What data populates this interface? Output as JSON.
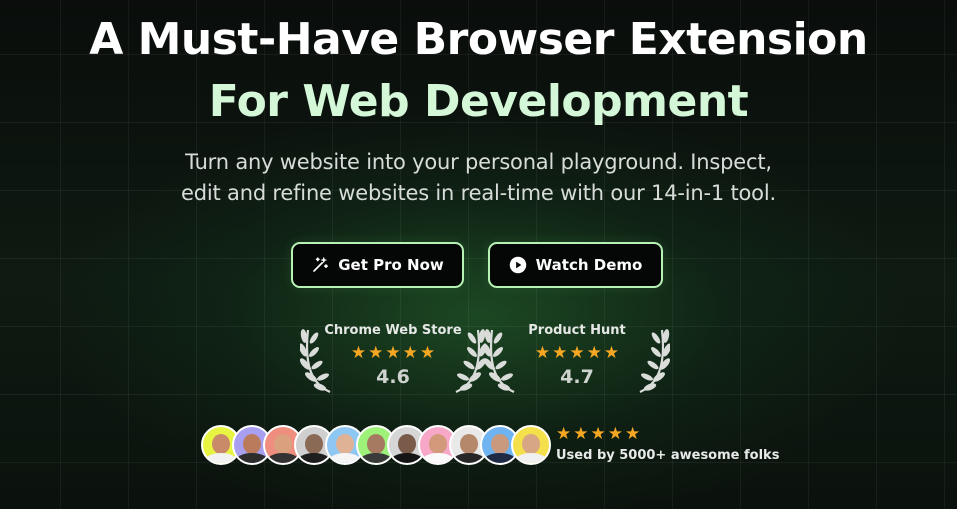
{
  "hero": {
    "headline_line1": "A Must-Have Browser Extension",
    "headline_line2": "For Web Development",
    "subtitle_line1": "Turn any website into your personal playground. Inspect,",
    "subtitle_line2": "edit and refine websites in real-time with our 14-in-1 tool."
  },
  "buttons": {
    "get_pro": {
      "label": "Get Pro Now",
      "icon": "magic-wand-icon"
    },
    "watch_demo": {
      "label": "Watch Demo",
      "icon": "play-icon"
    }
  },
  "ratings": [
    {
      "source": "Chrome Web Store",
      "score": "4.6",
      "stars": 5
    },
    {
      "source": "Product Hunt",
      "score": "4.7",
      "stars": 5
    }
  ],
  "social_proof": {
    "stars": 5,
    "label": "Used by 5000+ awesome folks",
    "avatar_count": 11
  },
  "colors": {
    "accent_border": "#b7f2b4",
    "headline_accent": "#d4f7d8",
    "star": "#f5a623",
    "background": "#0b0e0c"
  }
}
